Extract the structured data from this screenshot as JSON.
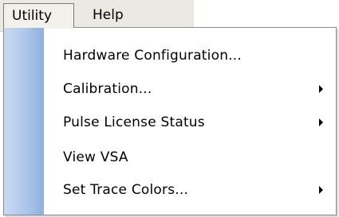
{
  "menubar": {
    "items": [
      {
        "label": "Utility",
        "state": "open"
      },
      {
        "label": "Help"
      }
    ]
  },
  "utility_menu": {
    "items": [
      {
        "label": "Hardware Configuration...",
        "has_submenu": false
      },
      {
        "label": "Calibration...",
        "has_submenu": true
      },
      {
        "label": "Pulse License Status",
        "has_submenu": true
      },
      {
        "label": "View VSA",
        "has_submenu": false
      },
      {
        "label": "Set Trace Colors...",
        "has_submenu": true
      }
    ],
    "submenu_icon": "chevron-right-icon"
  },
  "colors": {
    "menubar_bg": "#ebe9e2",
    "gutter_light": "#c9d9f1",
    "gutter_dark": "#8fb0e0",
    "menu_bg": "#ffffff"
  }
}
